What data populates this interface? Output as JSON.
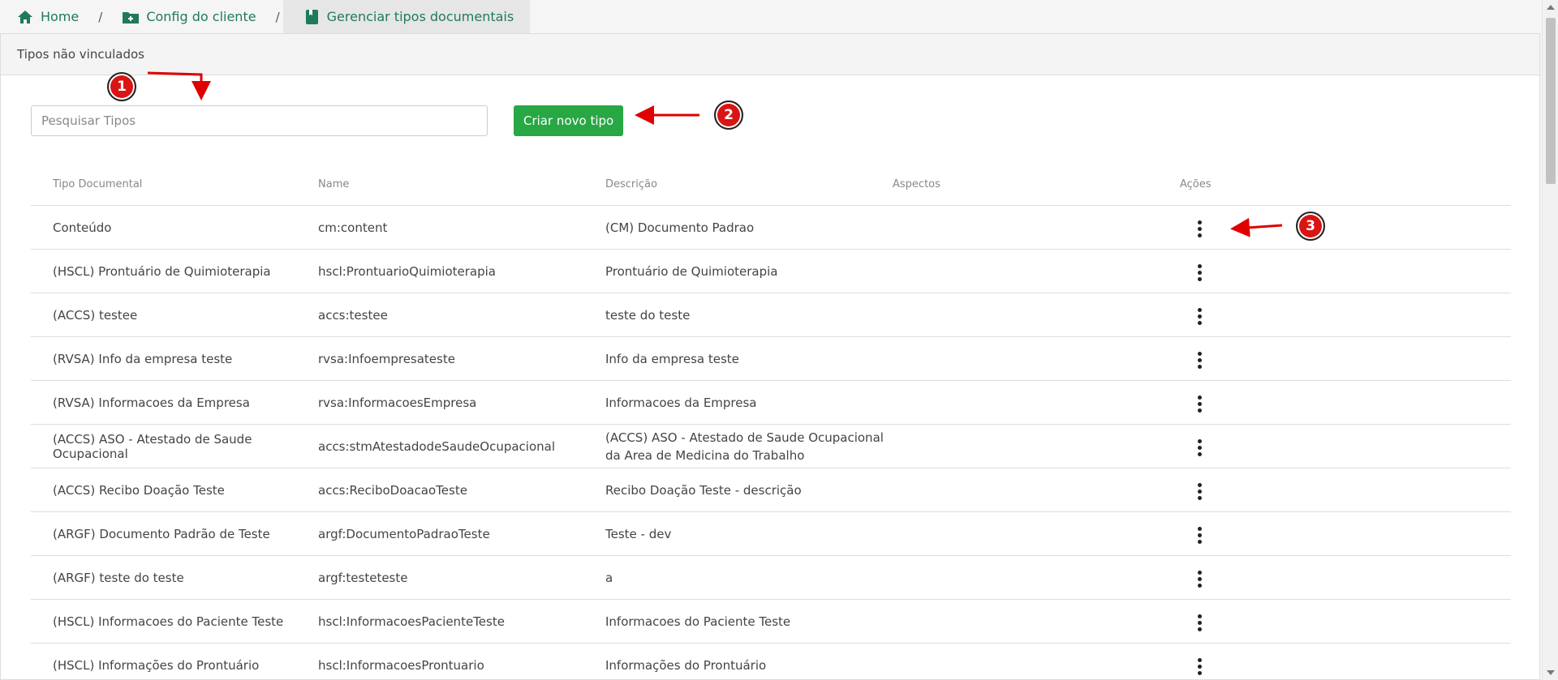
{
  "breadcrumb": {
    "home": "Home",
    "client_config": "Config do cliente",
    "manage_types": "Gerenciar tipos documentais",
    "separator": "/"
  },
  "panel": {
    "title": "Tipos não vinculados"
  },
  "search": {
    "placeholder": "Pesquisar Tipos",
    "value": ""
  },
  "toolbar": {
    "create_label": "Criar novo tipo"
  },
  "table": {
    "headers": [
      "Tipo Documental",
      "Name",
      "Descrição",
      "Aspectos",
      "Ações"
    ],
    "rows": [
      {
        "tipo": "Conteúdo",
        "name": "cm:content",
        "descricao": "(CM) Documento Padrao",
        "aspectos": ""
      },
      {
        "tipo": "(HSCL) Prontuário de Quimioterapia",
        "name": "hscl:ProntuarioQuimioterapia",
        "descricao": "Prontuário de Quimioterapia",
        "aspectos": ""
      },
      {
        "tipo": "(ACCS) testee",
        "name": "accs:testee",
        "descricao": "teste do teste",
        "aspectos": ""
      },
      {
        "tipo": "(RVSA) Info da empresa teste",
        "name": "rvsa:Infoempresateste",
        "descricao": "Info da empresa teste",
        "aspectos": ""
      },
      {
        "tipo": "(RVSA) Informacoes da Empresa",
        "name": "rvsa:InformacoesEmpresa",
        "descricao": "Informacoes da Empresa",
        "aspectos": ""
      },
      {
        "tipo": "(ACCS) ASO - Atestado de Saude Ocupacional",
        "name": "accs:stmAtestadodeSaudeOcupacional",
        "descricao": "(ACCS) ASO - Atestado de Saude Ocupacional da Area de Medicina do Trabalho",
        "aspectos": ""
      },
      {
        "tipo": "(ACCS) Recibo Doação Teste",
        "name": "accs:ReciboDoacaoTeste",
        "descricao": "Recibo Doação Teste - descrição",
        "aspectos": ""
      },
      {
        "tipo": "(ARGF) Documento Padrão de Teste",
        "name": "argf:DocumentoPadraoTeste",
        "descricao": "Teste - dev",
        "aspectos": ""
      },
      {
        "tipo": "(ARGF) teste do teste",
        "name": "argf:testeteste",
        "descricao": "a",
        "aspectos": ""
      },
      {
        "tipo": "(HSCL) Informacoes do Paciente Teste",
        "name": "hscl:InformacoesPacienteTeste",
        "descricao": "Informacoes do Paciente Teste",
        "aspectos": ""
      },
      {
        "tipo": "(HSCL) Informações do Prontuário",
        "name": "hscl:InformacoesProntuario",
        "descricao": "Informações do Prontuário",
        "aspectos": ""
      }
    ]
  },
  "annotations": {
    "badge1": "1",
    "badge2": "2",
    "badge3": "3"
  },
  "colors": {
    "accent": "#1f7a5c",
    "button_green": "#28a745",
    "annotation_red": "#d91414"
  }
}
